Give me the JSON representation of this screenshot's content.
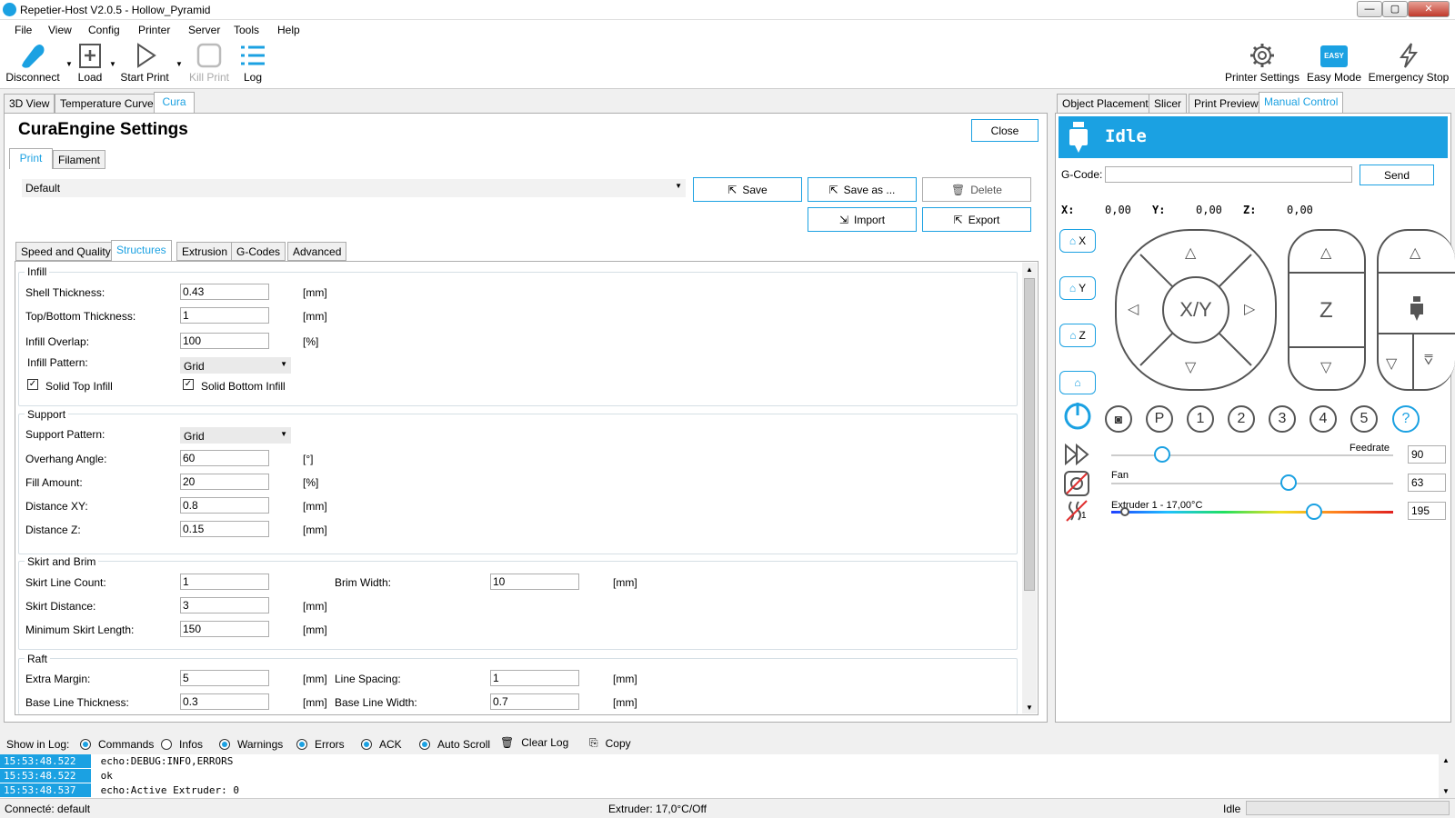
{
  "window": {
    "title": "Repetier-Host V2.0.5 - Hollow_Pyramid"
  },
  "menu": [
    "File",
    "View",
    "Config",
    "Printer",
    "Server",
    "Tools",
    "Help"
  ],
  "toolbar": {
    "disconnect": "Disconnect",
    "load": "Load",
    "start_print": "Start Print",
    "kill_print": "Kill Print",
    "log": "Log",
    "printer_settings": "Printer Settings",
    "easy_mode": "Easy Mode",
    "easy_badge": "EASY",
    "emergency_stop": "Emergency Stop"
  },
  "left_tabs": [
    "3D View",
    "Temperature Curve",
    "Cura"
  ],
  "right_tabs": [
    "Object Placement",
    "Slicer",
    "Print Preview",
    "Manual Control"
  ],
  "cura": {
    "heading": "CuraEngine Settings",
    "close": "Close",
    "subtabs": [
      "Print",
      "Filament"
    ],
    "profile": "Default",
    "buttons": {
      "save": "Save",
      "save_as": "Save as ...",
      "delete": "Delete",
      "import": "Import",
      "export": "Export"
    },
    "settings_tabs": [
      "Speed and Quality",
      "Structures",
      "Extrusion",
      "G-Codes",
      "Advanced"
    ],
    "infill": {
      "title": "Infill",
      "shell_label": "Shell Thickness:",
      "shell_value": "0.43",
      "shell_unit": "[mm]",
      "topbottom_label": "Top/Bottom Thickness:",
      "topbottom_value": "1",
      "topbottom_unit": "[mm]",
      "overlap_label": "Infill Overlap:",
      "overlap_value": "100",
      "overlap_unit": "[%]",
      "pattern_label": "Infill Pattern:",
      "pattern_value": "Grid",
      "solid_top": "Solid Top Infill",
      "solid_bottom": "Solid Bottom Infill"
    },
    "support": {
      "title": "Support",
      "pattern_label": "Support Pattern:",
      "pattern_value": "Grid",
      "overhang_label": "Overhang Angle:",
      "overhang_value": "60",
      "overhang_unit": "[°]",
      "fill_label": "Fill Amount:",
      "fill_value": "20",
      "fill_unit": "[%]",
      "dxy_label": "Distance XY:",
      "dxy_value": "0.8",
      "dxy_unit": "[mm]",
      "dz_label": "Distance Z:",
      "dz_value": "0.15",
      "dz_unit": "[mm]"
    },
    "skirt": {
      "title": "Skirt and Brim",
      "count_label": "Skirt Line Count:",
      "count_value": "1",
      "brim_label": "Brim Width:",
      "brim_value": "10",
      "brim_unit": "[mm]",
      "distance_label": "Skirt Distance:",
      "distance_value": "3",
      "distance_unit": "[mm]",
      "minlen_label": "Minimum Skirt Length:",
      "minlen_value": "150",
      "minlen_unit": "[mm]"
    },
    "raft": {
      "title": "Raft",
      "margin_label": "Extra Margin:",
      "margin_value": "5",
      "margin_unit": "[mm]",
      "spacing_label": "Line Spacing:",
      "spacing_value": "1",
      "spacing_unit": "[mm]",
      "base_thick_label": "Base Line Thickness:",
      "base_thick_value": "0.3",
      "base_thick_unit": "[mm]",
      "base_width_label": "Base Line Width:",
      "base_width_value": "0.7",
      "base_width_unit": "[mm]"
    }
  },
  "manual": {
    "status": "Idle",
    "gcode_label": "G-Code:",
    "gcode_value": "",
    "send": "Send",
    "x_label": "X:",
    "x_value": "0,00",
    "y_label": "Y:",
    "y_value": "0,00",
    "z_label": "Z:",
    "z_value": "0,00",
    "home": [
      "X",
      "Y",
      "Z"
    ],
    "xy_label": "X/Y",
    "z_pad_label": "Z",
    "buttons": [
      "P",
      "1",
      "2",
      "3",
      "4",
      "5",
      "?"
    ],
    "feedrate_label": "Feedrate",
    "feedrate_value": "90",
    "feedrate_level": 0.18,
    "fan_label": "Fan",
    "fan_value": "63",
    "fan_level": 0.63,
    "extruder_label": "Extruder 1 - 17,00°C",
    "extruder_value": "195",
    "extruder_level": 0.72,
    "extruder_index": "1",
    "accent": "#1ba1e2"
  },
  "log": {
    "show_label": "Show in Log:",
    "options": [
      {
        "label": "Commands",
        "on": true
      },
      {
        "label": "Infos",
        "on": false
      },
      {
        "label": "Warnings",
        "on": true
      },
      {
        "label": "Errors",
        "on": true
      },
      {
        "label": "ACK",
        "on": true
      },
      {
        "label": "Auto Scroll",
        "on": true
      }
    ],
    "clear": "Clear Log",
    "copy": "Copy",
    "rows": [
      {
        "time": "15:53:48.522",
        "text": "echo:DEBUG:INFO,ERRORS"
      },
      {
        "time": "15:53:48.522",
        "text": "ok"
      },
      {
        "time": "15:53:48.537",
        "text": "echo:Active Extruder: 0"
      }
    ]
  },
  "statusbar": {
    "connection": "Connecté: default",
    "extruder": "Extruder: 17,0°C/Off",
    "state": "Idle"
  }
}
